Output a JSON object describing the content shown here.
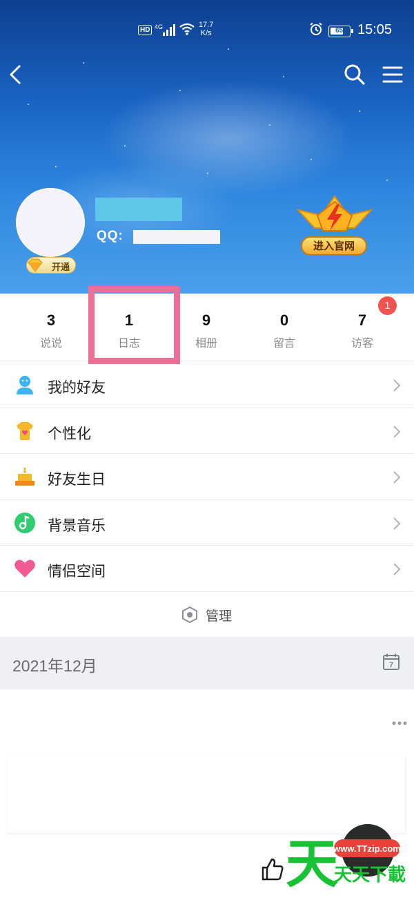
{
  "status_bar": {
    "hd": "HD",
    "network": "4G",
    "speed_value": "17.7",
    "speed_unit": "K/s",
    "battery": "65",
    "time": "15:05"
  },
  "profile": {
    "vip_label": "开通",
    "qq_label": "QQ:",
    "official_label": "进入官网"
  },
  "stats": [
    {
      "count": "3",
      "label": "说说"
    },
    {
      "count": "1",
      "label": "日志"
    },
    {
      "count": "9",
      "label": "相册"
    },
    {
      "count": "0",
      "label": "留言"
    },
    {
      "count": "7",
      "label": "访客"
    }
  ],
  "visitor_badge": "1",
  "menu": [
    {
      "label": "我的好友",
      "icon": "friends-icon"
    },
    {
      "label": "个性化",
      "icon": "personalize-icon"
    },
    {
      "label": "好友生日",
      "icon": "birthday-cake-icon"
    },
    {
      "label": "背景音乐",
      "icon": "music-icon"
    },
    {
      "label": "情侣空间",
      "icon": "heart-icon"
    }
  ],
  "manage_label": "管理",
  "month": "2021年12月",
  "calendar_day": "7",
  "watermark": {
    "url": "www.TTzip.com",
    "text": "天天下載",
    "big": "天"
  },
  "colors": {
    "highlight": "#ee6f95",
    "badge": "#f2534f",
    "sky_top": "#0d3f8f",
    "sky_bottom": "#4aa0ea"
  }
}
